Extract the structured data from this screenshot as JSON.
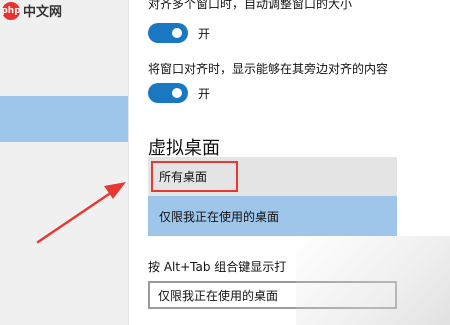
{
  "logo": {
    "badge": "php",
    "text": "中文网"
  },
  "settings": {
    "setting1_label": "对齐多个窗口时，自动调整窗口的大小",
    "setting1_state": "开",
    "setting2_label": "将窗口对齐时，显示能够在其旁边对齐的内容",
    "setting2_state": "开"
  },
  "virtual_desktops": {
    "title": "虚拟桌面",
    "dropdown_options": [
      "所有桌面",
      "仅限我正在使用的桌面"
    ],
    "selected_option": "仅限我正在使用的桌面",
    "alt_tab_label": "按 Alt+Tab 组合键显示打",
    "alt_tab_value": "仅限我正在使用的桌面"
  },
  "colors": {
    "accent": "#1a78c2",
    "selection": "#9ec6ea",
    "annotation": "#e53935"
  },
  "icons": [
    "toggle-switch",
    "annotation-arrow"
  ]
}
